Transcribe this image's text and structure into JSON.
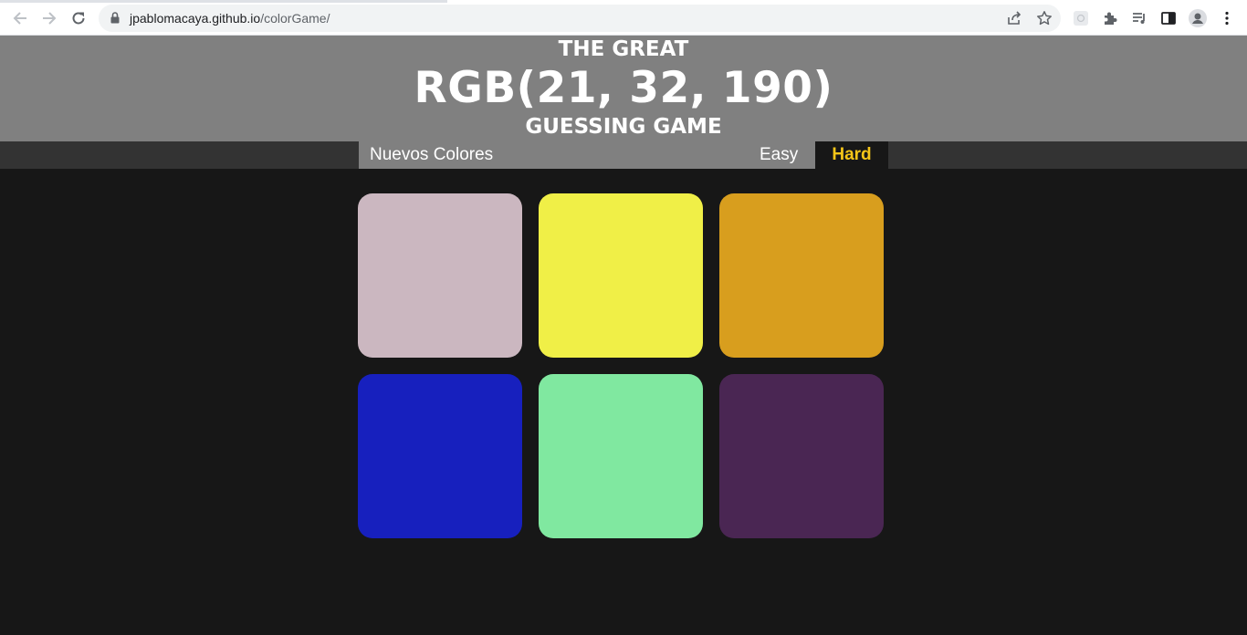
{
  "browser": {
    "url_host": "jpablomacaya.github.io",
    "url_path": "/colorGame/",
    "icons": [
      "back-icon",
      "forward-icon",
      "reload-icon",
      "lock-icon",
      "share-icon",
      "star-icon",
      "extension-tile-icon",
      "puzzle-icon",
      "media-queue-icon",
      "side-panel-icon",
      "profile-icon",
      "menu-icon"
    ]
  },
  "header": {
    "line1": "THE GREAT",
    "rgb_display": "RGB(21, 32, 190)",
    "line3": "GUESSING GAME",
    "background": "#808080"
  },
  "controls": {
    "new_colors_label": "Nuevos Colores",
    "easy_label": "Easy",
    "hard_label": "Hard",
    "selected_mode": "Hard",
    "selected_color": "#f5c518"
  },
  "squares": [
    {
      "color": "#cbb7c0"
    },
    {
      "color": "#f0ef47"
    },
    {
      "color": "#d89e1e"
    },
    {
      "color": "#1720be"
    },
    {
      "color": "#80e8a0"
    },
    {
      "color": "#4a2653"
    }
  ],
  "page_background": "#171717"
}
